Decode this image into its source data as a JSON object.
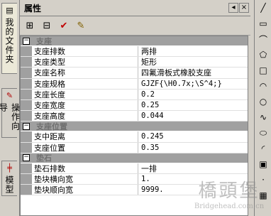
{
  "left_tabs": [
    {
      "label": "我的文件夹",
      "icon": "folder-icon"
    },
    {
      "label": "操作向导",
      "icon": "wizard-icon"
    },
    {
      "label": "模型",
      "icon": "model-icon"
    }
  ],
  "panel": {
    "title": "属性",
    "close_glyph": "×",
    "pin_glyph": "◂"
  },
  "toolbar": {
    "buttons": [
      "expand-all-icon",
      "collapse-all-icon",
      "confirm-check-icon",
      "edit-icon"
    ]
  },
  "grid": {
    "categories": [
      {
        "label": "支座",
        "expanded": true,
        "rows": [
          {
            "name": "支座排数",
            "value": "两排"
          },
          {
            "name": "支座类型",
            "value": "矩形"
          },
          {
            "name": "支座名称",
            "value": "四氟滑板式橡胶支座"
          },
          {
            "name": "支座规格",
            "value": "GJZF{\\H0.7x;\\S^4;}"
          },
          {
            "name": "支座长度",
            "value": "0.2"
          },
          {
            "name": "支座宽度",
            "value": "0.25"
          },
          {
            "name": "支座高度",
            "value": "0.044"
          }
        ]
      },
      {
        "label": "支座位置",
        "expanded": true,
        "rows": [
          {
            "name": "支中距离",
            "value": "0.245"
          },
          {
            "name": "支座位置",
            "value": "0.35"
          }
        ]
      },
      {
        "label": "垫石",
        "expanded": true,
        "rows": [
          {
            "name": "垫石排数",
            "value": "一排"
          },
          {
            "name": "垫块横向宽",
            "value": "1."
          },
          {
            "name": "垫块顺向宽",
            "value": "9999."
          }
        ]
      }
    ]
  },
  "watermark": {
    "cn": "橋頭堡",
    "en": "Bridgehead.com.cn"
  }
}
